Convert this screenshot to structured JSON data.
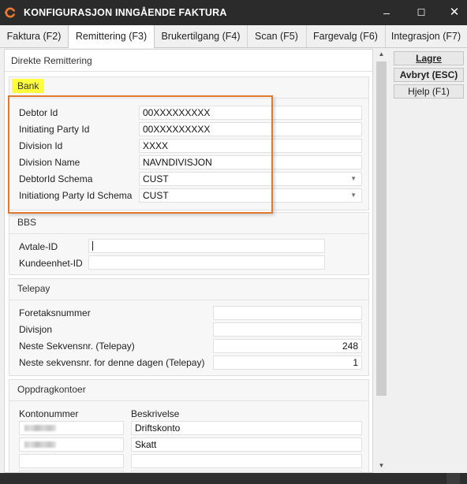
{
  "window": {
    "title": "KONFIGURASJON INNGÅENDE FAKTURA",
    "icon": "app-logo-icon",
    "controls": {
      "minimize": "–",
      "maximize": "☐",
      "close": "✕"
    }
  },
  "tabs": [
    {
      "label": "Faktura (F2)"
    },
    {
      "label": "Remittering (F3)",
      "active": true
    },
    {
      "label": "Brukertilgang (F4)"
    },
    {
      "label": "Scan (F5)"
    },
    {
      "label": "Fargevalg (F6)"
    },
    {
      "label": "Integrasjon (F7)"
    }
  ],
  "main": {
    "title": "Direkte Remittering",
    "bank": {
      "title": "Bank",
      "fields": [
        {
          "label": "Debtor Id",
          "value": "00XXXXXXXXX"
        },
        {
          "label": "Initiating Party Id",
          "value": "00XXXXXXXXX"
        },
        {
          "label": "Division Id",
          "value": "XXXX"
        },
        {
          "label": "Division Name",
          "value": "NAVNDIVISJON"
        },
        {
          "label": "DebtorId Schema",
          "value": "CUST",
          "dropdown": true
        },
        {
          "label": "Initiationg Party Id Schema",
          "value": "CUST",
          "dropdown": true
        }
      ]
    },
    "bbs": {
      "title": "BBS",
      "fields": [
        {
          "label": "Avtale-ID",
          "value": ""
        },
        {
          "label": "Kundeenhet-ID",
          "value": ""
        }
      ]
    },
    "telepay": {
      "title": "Telepay",
      "fields": [
        {
          "label": "Foretaksnummer",
          "value": ""
        },
        {
          "label": "Divisjon",
          "value": ""
        },
        {
          "label": "Neste Sekvensnr. (Telepay)",
          "value": "248"
        },
        {
          "label": "Neste sekvensnr. for denne dagen (Telepay)",
          "value": "1"
        }
      ]
    },
    "oppdrag": {
      "title": "Oppdragkontoer",
      "col_konto": "Kontonummer",
      "col_beskrivelse": "Beskrivelse",
      "rows": [
        {
          "konto": "",
          "beskrivelse": "Driftskonto"
        },
        {
          "konto": "",
          "beskrivelse": "Skatt"
        },
        {
          "konto": "",
          "beskrivelse": ""
        },
        {
          "konto": "",
          "beskrivelse": ""
        }
      ]
    }
  },
  "buttons": {
    "save": "Lagre",
    "cancel": "Avbryt (ESC)",
    "help": "Hjelp (F1)"
  },
  "colors": {
    "highlight": "#ffff3c",
    "annotation_box": "#e07a2e",
    "titlebar": "#2b2b2b"
  }
}
